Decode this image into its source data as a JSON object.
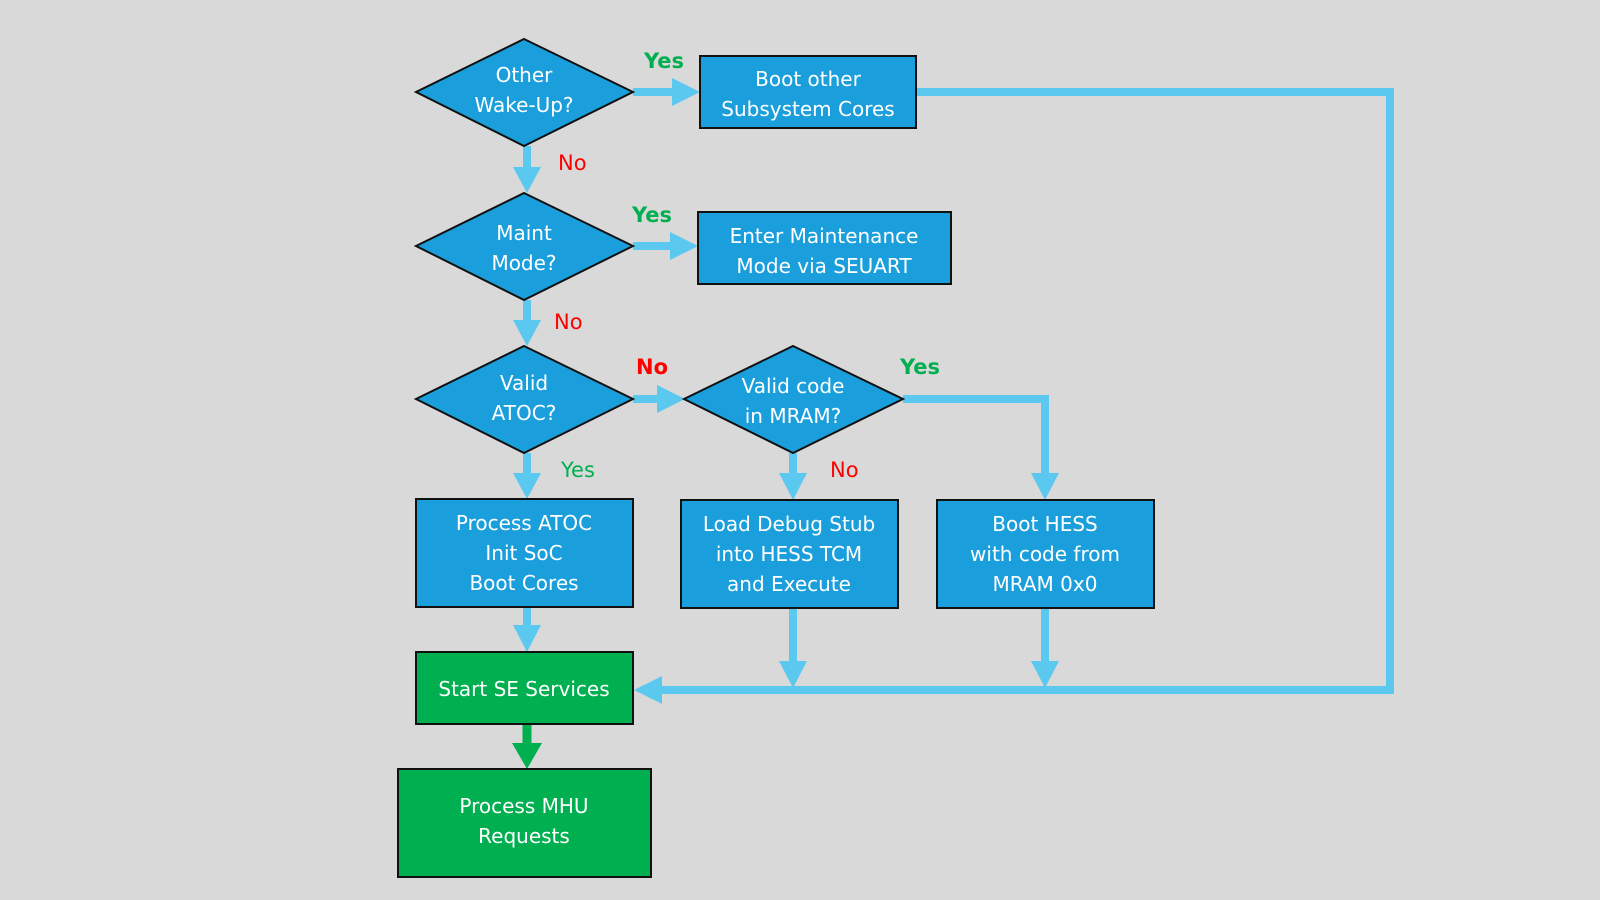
{
  "colors": {
    "background": "#d9d9d9",
    "process": "#1a9fdc",
    "terminal": "#00b050",
    "connector": "#5bc8f0",
    "yes": "#00b050",
    "no": "#ff0000"
  },
  "nodes": {
    "other_wakeup": [
      "Other",
      "Wake-Up?"
    ],
    "boot_other": [
      "Boot other",
      "Subsystem Cores"
    ],
    "maint_mode": [
      "Maint",
      "Mode?"
    ],
    "enter_maint": [
      "Enter Maintenance",
      "Mode via SEUART"
    ],
    "valid_atoc": [
      "Valid",
      "ATOC?"
    ],
    "valid_code": [
      "Valid code",
      "in MRAM?"
    ],
    "process_atoc": [
      "Process ATOC",
      "Init SoC",
      "Boot Cores"
    ],
    "load_debug": [
      "Load Debug Stub",
      "into HESS TCM",
      "and Execute"
    ],
    "boot_hess": [
      "Boot HESS",
      "with code from",
      "MRAM 0x0"
    ],
    "start_se": [
      "Start SE Services"
    ],
    "process_mhu": [
      "Process MHU",
      "Requests"
    ]
  },
  "labels": {
    "yes": "Yes",
    "no": "No"
  }
}
